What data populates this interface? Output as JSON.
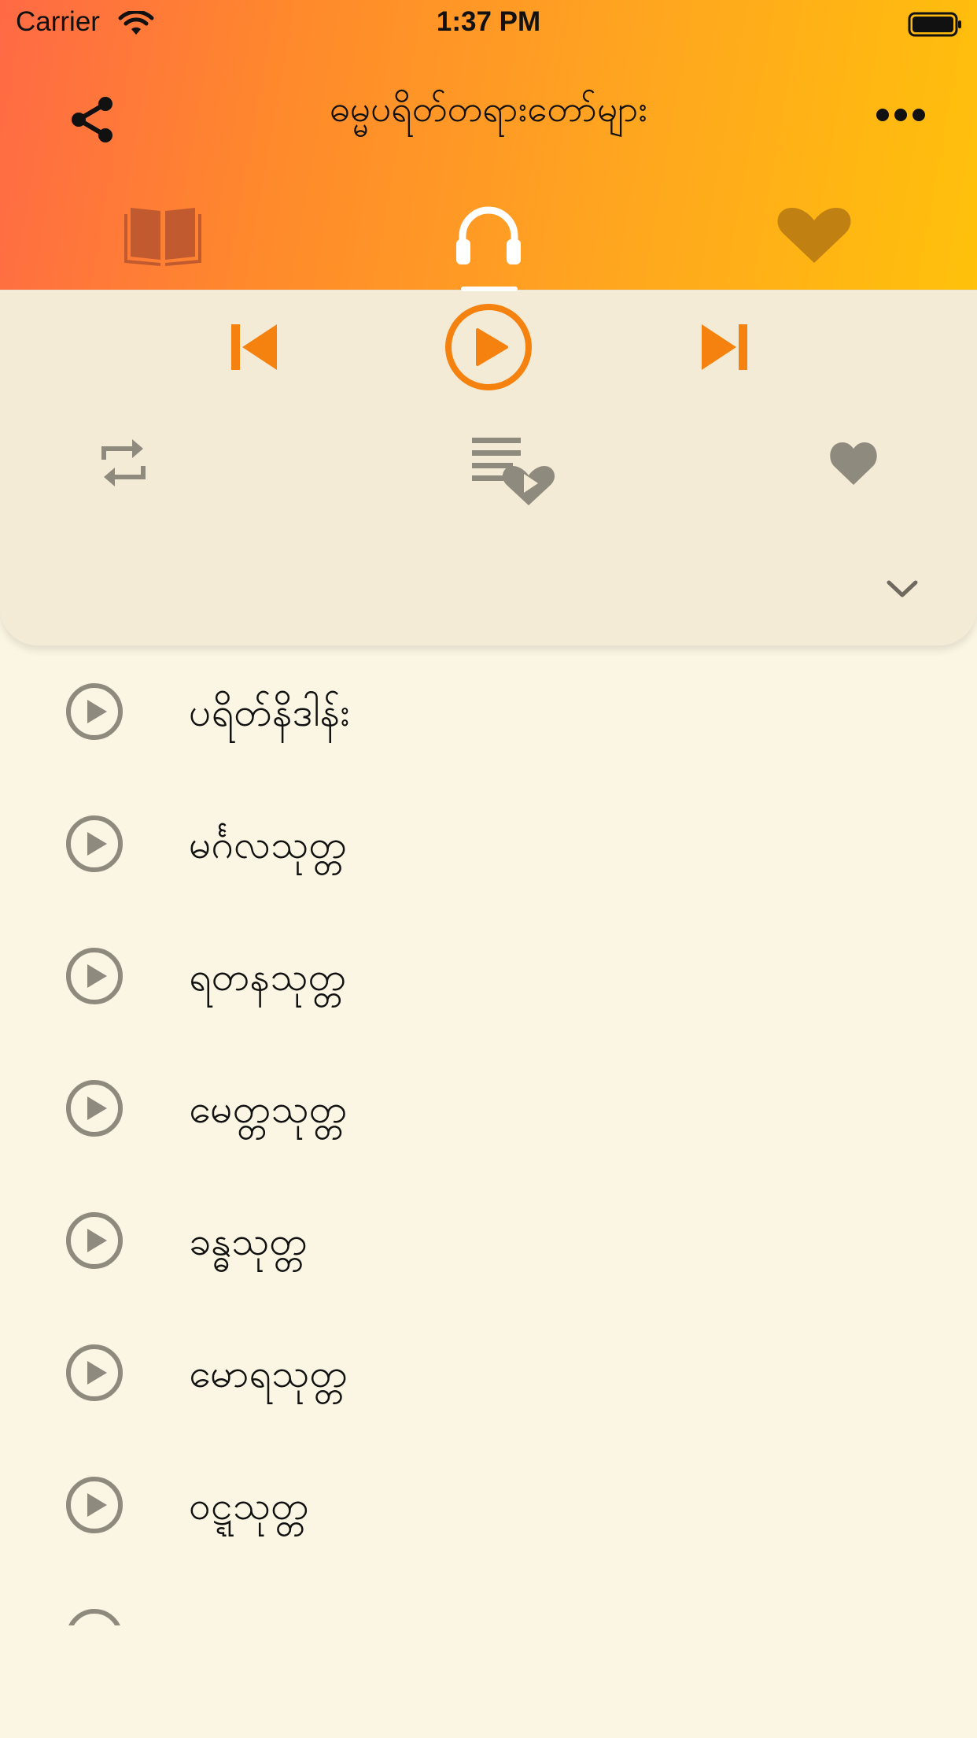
{
  "status_bar": {
    "carrier": "Carrier",
    "time": "1:37 PM"
  },
  "nav": {
    "title": "ဓမ္မပရိတ်တရားတော်များ",
    "share_icon": "share-icon",
    "more_icon": "more-icon"
  },
  "tabs": [
    {
      "name": "book",
      "icon": "book-icon",
      "active": false
    },
    {
      "name": "audio",
      "icon": "headphones-icon",
      "active": true
    },
    {
      "name": "favorites",
      "icon": "heart-icon",
      "active": false
    }
  ],
  "player": {
    "controls": [
      "previous-icon",
      "play-icon",
      "next-icon",
      "repeat-icon",
      "playlist-heart-icon",
      "heart-icon",
      "chevron-down-icon"
    ]
  },
  "tracks": [
    {
      "title": "ပရိတ်နိဒါန်း"
    },
    {
      "title": "မင်္ဂလသုတ္တ"
    },
    {
      "title": "ရတနသုတ္တ"
    },
    {
      "title": "မေတ္တသုတ္တ"
    },
    {
      "title": "ခန္ဓသုတ္တ"
    },
    {
      "title": "မောရသုတ္တ"
    },
    {
      "title": "ဝဋ္ဋသုတ္တ"
    }
  ],
  "colors": {
    "accent_orange": "#f5820f",
    "header_start": "#ff6a45",
    "header_end": "#ffc10b",
    "icon_gray": "#8f8a7e",
    "background": "#fbf6e3",
    "player_bg": "#f3ebd6"
  }
}
